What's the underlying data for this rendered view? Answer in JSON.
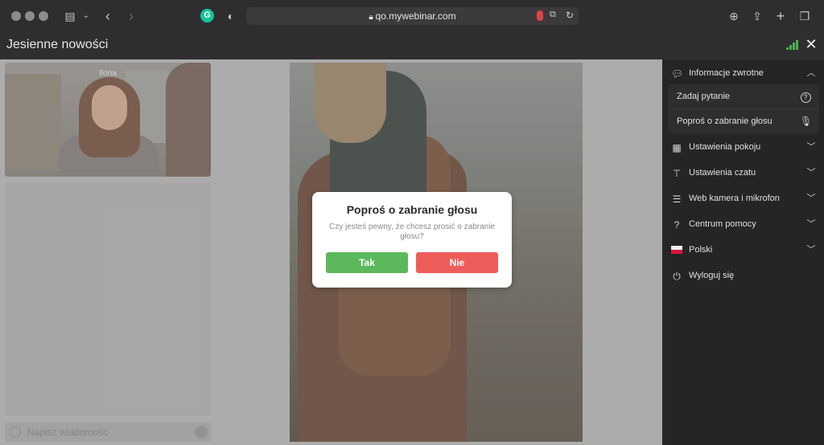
{
  "browser": {
    "url": "qo.mywebinar.com",
    "grammarly_letter": "G"
  },
  "app": {
    "title": "Jesienne nowości"
  },
  "video": {
    "participant_name": "Ilona"
  },
  "chat": {
    "placeholder": "Napisz wiadomość"
  },
  "modal": {
    "title": "Poproś o zabranie głosu",
    "text": "Czy jesteś pewny, że chcesz prosić o zabranie głosu?",
    "yes_label": "Tak",
    "no_label": "Nie"
  },
  "sidebar": {
    "items": [
      {
        "label": "Informacje zwrotne",
        "icon": "feedback-icon",
        "expanded": true
      },
      {
        "label": "Zadaj pytanie",
        "icon": "question-circle-icon"
      },
      {
        "label": "Poproś o zabranie głosu",
        "icon": "microphone-icon"
      },
      {
        "label": "Ustawienia pokoju",
        "icon": "layout-icon"
      },
      {
        "label": "Ustawienia czatu",
        "icon": "text-box-icon"
      },
      {
        "label": "Web kamera i mikrofon",
        "icon": "sliders-icon"
      },
      {
        "label": "Centrum pomocy",
        "icon": "question-mark-icon"
      },
      {
        "label": "Polski",
        "icon": "polish-flag-icon"
      },
      {
        "label": "Wyloguj się",
        "icon": "power-icon"
      }
    ]
  },
  "colors": {
    "accent_green": "#5cb85c",
    "accent_red": "#ee5c5a",
    "sidebar_bg": "#252527"
  }
}
